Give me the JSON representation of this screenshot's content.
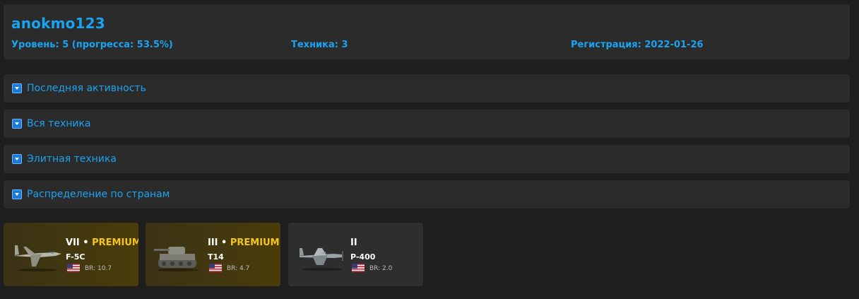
{
  "profile": {
    "username": "anokmo123",
    "level_text": "Уровень: 5 (прогресса: 53.5%)",
    "vehicles_text": "Техника: 3",
    "registration_text": "Регистрация: 2022-01-26"
  },
  "sections": [
    {
      "label": "Последняя активность"
    },
    {
      "label": "Вся техника"
    },
    {
      "label": "Элитная техника"
    },
    {
      "label": "Распределение по странам"
    }
  ],
  "vehicles": [
    {
      "tier": "VII",
      "separator": " • ",
      "premium": "PREMIUM",
      "name": "F-5C",
      "br": "BR: 10.7",
      "type_icon": "jet-aircraft-icon",
      "country_icon": "usa-flag-icon"
    },
    {
      "tier": "III",
      "separator": " • ",
      "premium": "PREMIUM",
      "name": "T14",
      "br": "BR: 4.7",
      "type_icon": "tank-icon",
      "country_icon": "usa-flag-icon"
    },
    {
      "tier": "II",
      "name": "P-400",
      "br": "BR: 2.0",
      "type_icon": "prop-aircraft-icon",
      "country_icon": "usa-flag-icon"
    }
  ],
  "colors": {
    "accent": "#1aa3f0",
    "premium": "#f5c518",
    "background": "#1e1e1e",
    "panel": "#2b2b2b"
  }
}
